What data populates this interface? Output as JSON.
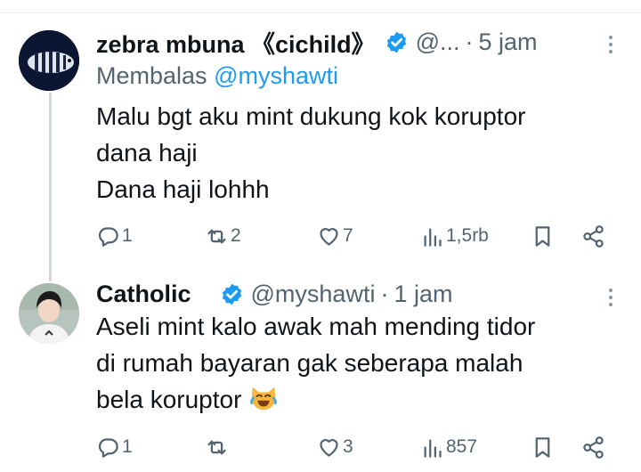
{
  "tweets": [
    {
      "display_name": "zebra mbuna 《cichild》",
      "handle": "@...",
      "separator": "·",
      "time": "5 jam",
      "reply_prefix": "Membalas",
      "reply_handle": "@myshawti",
      "lines": [
        "Malu bgt aku mint dukung kok koruptor",
        "dana haji",
        "Dana haji lohhh"
      ],
      "stats": {
        "replies": "1",
        "retweets": "2",
        "likes": "7",
        "views": "1,5rb"
      }
    },
    {
      "display_name": "Catholic",
      "handle": "@myshawti",
      "separator": "·",
      "time": "1 jam",
      "lines": [
        "Aseli mint kalo awak mah mending tidor",
        "di rumah bayaran gak seberapa malah",
        "bela koruptor"
      ],
      "emoji": "grinning-cat-with-tears-of-joy",
      "stats": {
        "replies": "1",
        "retweets": "",
        "likes": "3",
        "views": "857"
      }
    }
  ],
  "colors": {
    "text": "#0f1419",
    "muted": "#536471",
    "link": "#1d9bf0",
    "verified": "#1d9bf0",
    "thread_line": "#cfd9de"
  }
}
